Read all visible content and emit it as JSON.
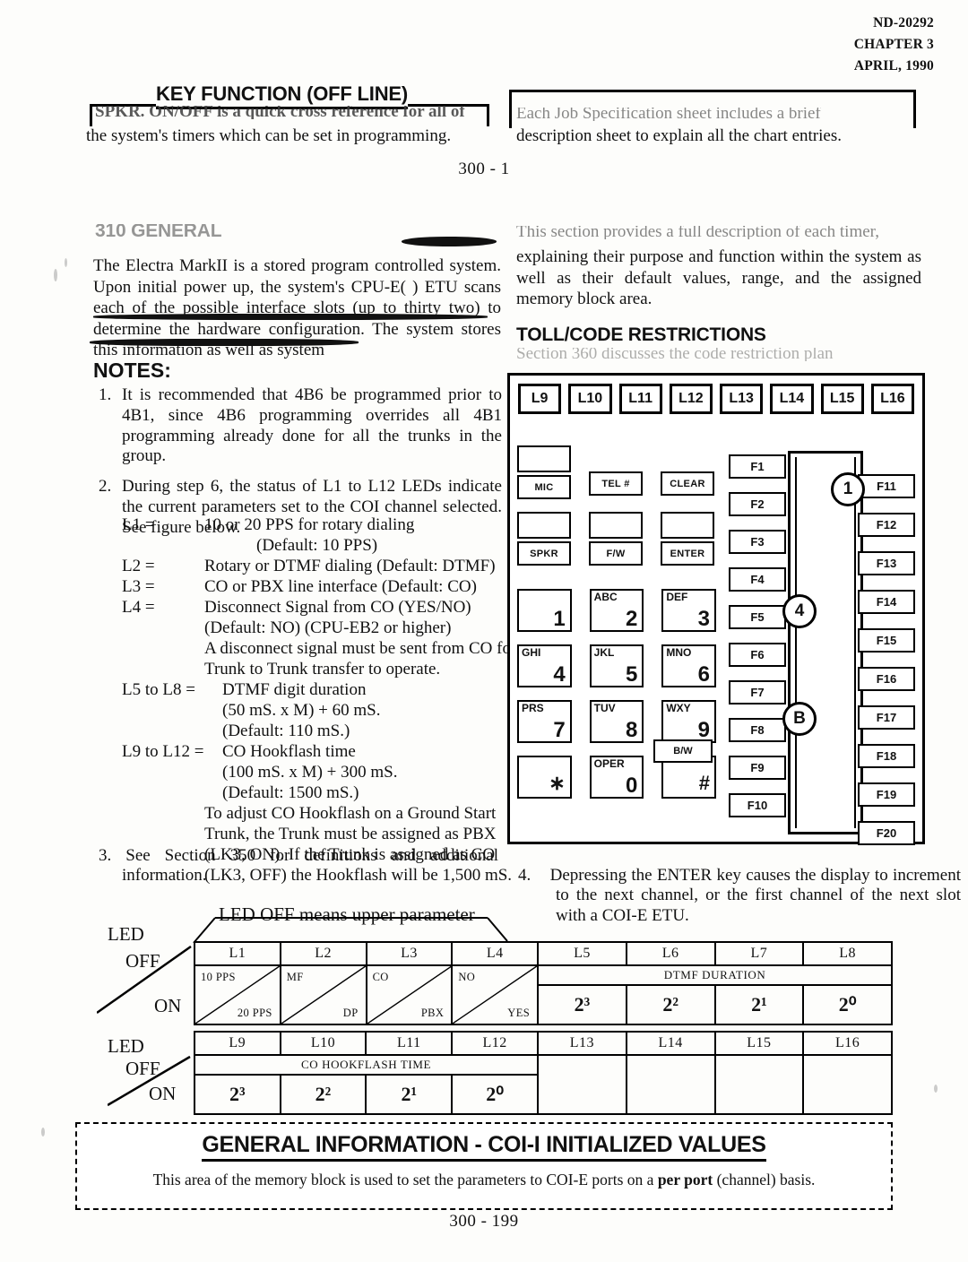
{
  "header": {
    "doc_number": "ND-20292",
    "chapter": "CHAPTER 3",
    "date": "APRIL, 1990"
  },
  "page_markers": {
    "top_center": "300 - 1",
    "bottom_center": "300 - 199"
  },
  "top_left_block": {
    "banner_title": "KEY FUNCTION (OFF LINE)",
    "ghost_line": "SPKR. ON/OFF     is a quick cross reference for all of",
    "line2": "the system's timers which can be set in programming."
  },
  "top_right_block": {
    "ghost_line": "Each Job Specification sheet includes a brief",
    "line2": "description sheet to explain all the chart entries."
  },
  "left_column": {
    "section_heading": "310 GENERAL",
    "body": "The Electra MarkII is a stored program controlled system.  Upon initial power up, the system's CPU-E( ) ETU scans each of the possible interface slots (up to thirty two) to determine the hardware configuration.  The system stores this information as well as system",
    "notes_heading": "NOTES:",
    "notes": [
      {
        "num": "1.",
        "text": "It is recommended that 4B6 be programmed prior to 4B1, since 4B6 programming overrides all 4B1 programming already done for all the trunks in the group."
      },
      {
        "num": "2.",
        "text": "During step 6, the status of L1 to L12 LEDs indicate the current parameters set to the COI channel selected.  See figure below."
      }
    ],
    "definitions": [
      {
        "key": "L1 =",
        "value": "10 or 20 PPS  for rotary dialing"
      },
      {
        "key": "",
        "value": "(Default: 10 PPS)",
        "indent": "3"
      },
      {
        "key": "L2 =",
        "value": "Rotary or DTMF dialing (Default:  DTMF)"
      },
      {
        "key": "L3 =",
        "value": "CO or PBX line interface (Default:  CO)"
      },
      {
        "key": "L4 =",
        "value": "Disconnect Signal from CO  (YES/NO)"
      },
      {
        "key": "",
        "value": "(Default: NO) (CPU-EB2 or higher)",
        "indent": "1"
      },
      {
        "key": "",
        "value": "A disconnect signal must be sent from CO for",
        "indent": "1"
      },
      {
        "key": "",
        "value": "Trunk to Trunk transfer to operate.",
        "indent": "1"
      },
      {
        "key": "L5 to L8 =",
        "value": "DTMF digit duration",
        "wide": true
      },
      {
        "key": "",
        "value": "(50 mS. x M) + 60 mS.",
        "indent": "2"
      },
      {
        "key": "",
        "value": "(Default:  110 mS.)",
        "indent": "2"
      },
      {
        "key": "L9 to L12 =",
        "value": "CO Hookflash time",
        "wide": true
      },
      {
        "key": "",
        "value": "(100 mS. x M) + 300 mS.",
        "indent": "2"
      },
      {
        "key": "",
        "value": "(Default:  1500 mS.)",
        "indent": "2"
      },
      {
        "key": "",
        "value": "To adjust CO Hookflash on a Ground Start",
        "indent": "1"
      },
      {
        "key": "",
        "value": "Trunk, the Trunk must be assigned as PBX",
        "indent": "1"
      },
      {
        "key": "",
        "value": "(LK3, ON).  If the Trunk is assigned as CO",
        "indent": "1"
      },
      {
        "key": "",
        "value": "(LK3, OFF) the Hookflash will be 1,500 mS.",
        "indent": "1"
      }
    ],
    "note3": {
      "num": "3.",
      "text": "See Section 350 for definitions and additional information."
    }
  },
  "right_column": {
    "ghost_line": "This section provides a full description of each timer,",
    "body": "explaining their purpose and function within the system as well as their default values, range, and the assigned memory block area.",
    "section_heading": "TOLL/CODE RESTRICTIONS",
    "ghost_line2": "Section 360 discusses the code restriction plan",
    "note4": {
      "num": "4.",
      "text": "Depressing the ENTER key causes the display to increment to the next channel, or the first channel of the next slot with a COI-E ETU."
    }
  },
  "figure": {
    "lamps": [
      "L9",
      "L10",
      "L11",
      "L12",
      "L13",
      "L14",
      "L15",
      "L16"
    ],
    "function_keys_left": [
      "F1",
      "F2",
      "F3",
      "F4",
      "F5",
      "F6",
      "F7",
      "F8",
      "F9",
      "F10"
    ],
    "function_keys_right": [
      "F11",
      "F12",
      "F13",
      "F14",
      "F15",
      "F16",
      "F17",
      "F18",
      "F19",
      "F20"
    ],
    "markers": [
      "1",
      "4",
      "B"
    ],
    "feature_keys": [
      {
        "label": "MIC",
        "has_lamp": false
      },
      {
        "label": "TEL #",
        "has_lamp": false
      },
      {
        "label": "CLEAR",
        "has_lamp": false
      },
      {
        "label": "SPKR",
        "has_lamp": true
      },
      {
        "label": "F/W",
        "has_lamp": true
      },
      {
        "label": "ENTER",
        "has_lamp": true
      }
    ],
    "mic_lamp_above": true,
    "dial_keys": [
      {
        "alpha": "",
        "digit": "1"
      },
      {
        "alpha": "ABC",
        "digit": "2"
      },
      {
        "alpha": "DEF",
        "digit": "3"
      },
      {
        "alpha": "GHI",
        "digit": "4"
      },
      {
        "alpha": "JKL",
        "digit": "5"
      },
      {
        "alpha": "MNO",
        "digit": "6"
      },
      {
        "alpha": "PRS",
        "digit": "7"
      },
      {
        "alpha": "TUV",
        "digit": "8"
      },
      {
        "alpha": "WXY",
        "digit": "9"
      },
      {
        "alpha": "",
        "digit": "∗"
      },
      {
        "alpha": "OPER",
        "digit": "0"
      },
      {
        "alpha": "",
        "digit": "#"
      }
    ],
    "bw_key": "B/W"
  },
  "led_tables": {
    "caption": "LED  OFF means upper parameter",
    "side_label": "LED",
    "off_label": "OFF",
    "on_label": "ON",
    "table1": {
      "headers": [
        "L1",
        "L2",
        "L3",
        "L4",
        "L5",
        "L6",
        "L7",
        "L8"
      ],
      "split_cells": [
        {
          "off": "10 PPS",
          "on": "20 PPS"
        },
        {
          "off": "MF",
          "on": "DP"
        },
        {
          "off": "CO",
          "on": "PBX"
        },
        {
          "off": "NO",
          "on": "YES"
        }
      ],
      "span_label": "DTMF DURATION",
      "weights": [
        "2³",
        "2²",
        "2¹",
        "2⁰"
      ]
    },
    "table2": {
      "headers": [
        "L9",
        "L10",
        "L11",
        "L12",
        "L13",
        "L14",
        "L15",
        "L16"
      ],
      "span_label": "CO HOOKFLASH TIME",
      "weights": [
        "2³",
        "2²",
        "2¹",
        "2⁰"
      ],
      "empty_cells": 4
    }
  },
  "bottom_box": {
    "title_part1": "GENERAL INFORMATION  -  COI-I  INITIALIZED VALUES",
    "body_before": "This area of the memory block is used to set the parameters to COI-E ports on a ",
    "body_bold": "per port",
    "body_after": " (channel) basis."
  }
}
